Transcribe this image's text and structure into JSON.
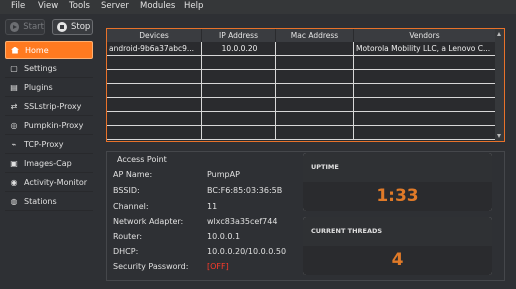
{
  "menu": [
    "File",
    "View",
    "Tools",
    "Server",
    "Modules",
    "Help"
  ],
  "toolbar": {
    "start_label": "Start",
    "stop_label": "Stop"
  },
  "sidebar": {
    "items": [
      {
        "label": "Home",
        "icon": "home-icon",
        "active": true
      },
      {
        "label": "Settings",
        "icon": "settings-icon"
      },
      {
        "label": "Plugins",
        "icon": "plugins-icon"
      },
      {
        "label": "SSLstrip-Proxy",
        "icon": "sslstrip-proxy-icon"
      },
      {
        "label": "Pumpkin-Proxy",
        "icon": "pumpkin-proxy-icon"
      },
      {
        "label": "TCP-Proxy",
        "icon": "tcp-proxy-icon"
      },
      {
        "label": "Images-Cap",
        "icon": "images-cap-icon"
      },
      {
        "label": "Activity-Monitor",
        "icon": "activity-monitor-icon"
      },
      {
        "label": "Stations",
        "icon": "stations-icon"
      }
    ]
  },
  "clients_table": {
    "columns": [
      "Devices",
      "IP Address",
      "Mac Address",
      "Vendors"
    ],
    "rows": [
      [
        "android-9b6a37abc9...",
        "10.0.0.20",
        "",
        "Motorola Mobility LLC, a Lenovo C..."
      ],
      [
        "",
        "",
        "",
        ""
      ],
      [
        "",
        "",
        "",
        ""
      ],
      [
        "",
        "",
        "",
        ""
      ],
      [
        "",
        "",
        "",
        ""
      ],
      [
        "",
        "",
        "",
        ""
      ],
      [
        "",
        "",
        "",
        ""
      ]
    ]
  },
  "access_point": {
    "title": "Access Point",
    "fields": [
      {
        "label": "AP Name:",
        "value": "PumpAP"
      },
      {
        "label": "BSSID:",
        "value": "BC:F6:85:03:36:5B"
      },
      {
        "label": "Channel:",
        "value": "11"
      },
      {
        "label": "Network Adapter:",
        "value": "wlxc83a35cef744"
      },
      {
        "label": "Router:",
        "value": "10.0.0.1"
      },
      {
        "label": "DHCP:",
        "value": "10.0.0.20/10.0.0.50"
      },
      {
        "label": "Security Password:",
        "value": "[OFF]"
      }
    ]
  },
  "uptime": {
    "label": "UPTIME",
    "value": "1:33"
  },
  "threads": {
    "label": "CURRENT THREADS",
    "value": "4"
  },
  "colors": {
    "accent": "#ff7a20",
    "off": "#ff3a2a"
  }
}
